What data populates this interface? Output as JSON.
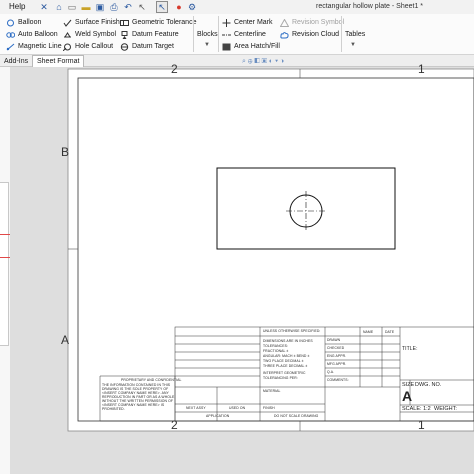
{
  "menu": {
    "help": "Help"
  },
  "window": {
    "title": "rectangular hollow plate - Sheet1 *"
  },
  "ribbon": {
    "annotations": [
      {
        "label": "Balloon",
        "icon": "balloon-icon"
      },
      {
        "label": "Auto Balloon",
        "icon": "auto-balloon-icon"
      },
      {
        "label": "Magnetic Line",
        "icon": "magnetic-line-icon"
      },
      {
        "label": "Surface Finish",
        "icon": "surface-finish-icon"
      },
      {
        "label": "Weld Symbol",
        "icon": "weld-symbol-icon"
      },
      {
        "label": "Hole Callout",
        "icon": "hole-callout-icon"
      },
      {
        "label": "Geometric Tolerance",
        "icon": "geometric-tolerance-icon"
      },
      {
        "label": "Datum Feature",
        "icon": "datum-feature-icon"
      },
      {
        "label": "Datum Target",
        "icon": "datum-target-icon"
      },
      {
        "label": "Center Mark",
        "icon": "center-mark-icon"
      },
      {
        "label": "Centerline",
        "icon": "centerline-icon"
      },
      {
        "label": "Area Hatch/Fill",
        "icon": "area-hatch-icon"
      },
      {
        "label": "Revision Symbol",
        "icon": "revision-symbol-icon",
        "disabled": true
      },
      {
        "label": "Revision Cloud",
        "icon": "revision-cloud-icon"
      }
    ],
    "blocks_label": "Blocks",
    "tables_label": "Tables"
  },
  "tabs": [
    {
      "label": "Add-Ins",
      "active": false
    },
    {
      "label": "Sheet Format",
      "active": true
    }
  ],
  "sheet": {
    "zones_top": [
      "2",
      "1"
    ],
    "zones_bottom": [
      "2",
      "1"
    ],
    "zones_left": [
      "B",
      "A"
    ],
    "title_block": {
      "unless": "UNLESS OTHERWISE SPECIFIED:",
      "name": "NAME",
      "date": "DATE",
      "dim_lines": [
        "DIMENSIONS ARE IN INCHES",
        "TOLERANCES:",
        "FRACTIONAL ±",
        "ANGULAR: MACH ±   BEND ±",
        "TWO PLACE DECIMAL   ±",
        "THREE PLACE DECIMAL  ±"
      ],
      "interpret": [
        "INTERPRET GEOMETRIC",
        "TOLERANCING PER:"
      ],
      "material": "MATERIAL",
      "finish": "FINISH",
      "drawn": "DRAWN",
      "checked": "CHECKED",
      "eng_appr": "ENG APPR.",
      "mfg_appr": "MFG APPR.",
      "qa": "Q.A.",
      "comments": "COMMENTS:",
      "title": "TITLE:",
      "proprietary": "PROPRIETARY AND CONFIDENTIAL",
      "prop_lines": [
        "THE INFORMATION CONTAINED IN THIS",
        "DRAWING IS THE SOLE PROPERTY OF",
        "<INSERT COMPANY NAME HERE>. ANY",
        "REPRODUCTION IN PART OR AS A WHOLE",
        "WITHOUT THE WRITTEN PERMISSION OF",
        "<INSERT COMPANY NAME HERE> IS",
        "PROHIBITED."
      ],
      "next_assy": "NEXT ASSY",
      "used_on": "USED ON",
      "application": "APPLICATION",
      "do_not_scale": "DO NOT SCALE DRAWING",
      "size": "SIZE",
      "dwg_no": "DWG.  NO.",
      "size_value": "A",
      "scale": "SCALE: 1:2",
      "weight": "WEIGHT:"
    }
  },
  "colors": {
    "sheet_bg": "#dedede",
    "paper": "#ffffff",
    "highlight": "#e04848"
  }
}
